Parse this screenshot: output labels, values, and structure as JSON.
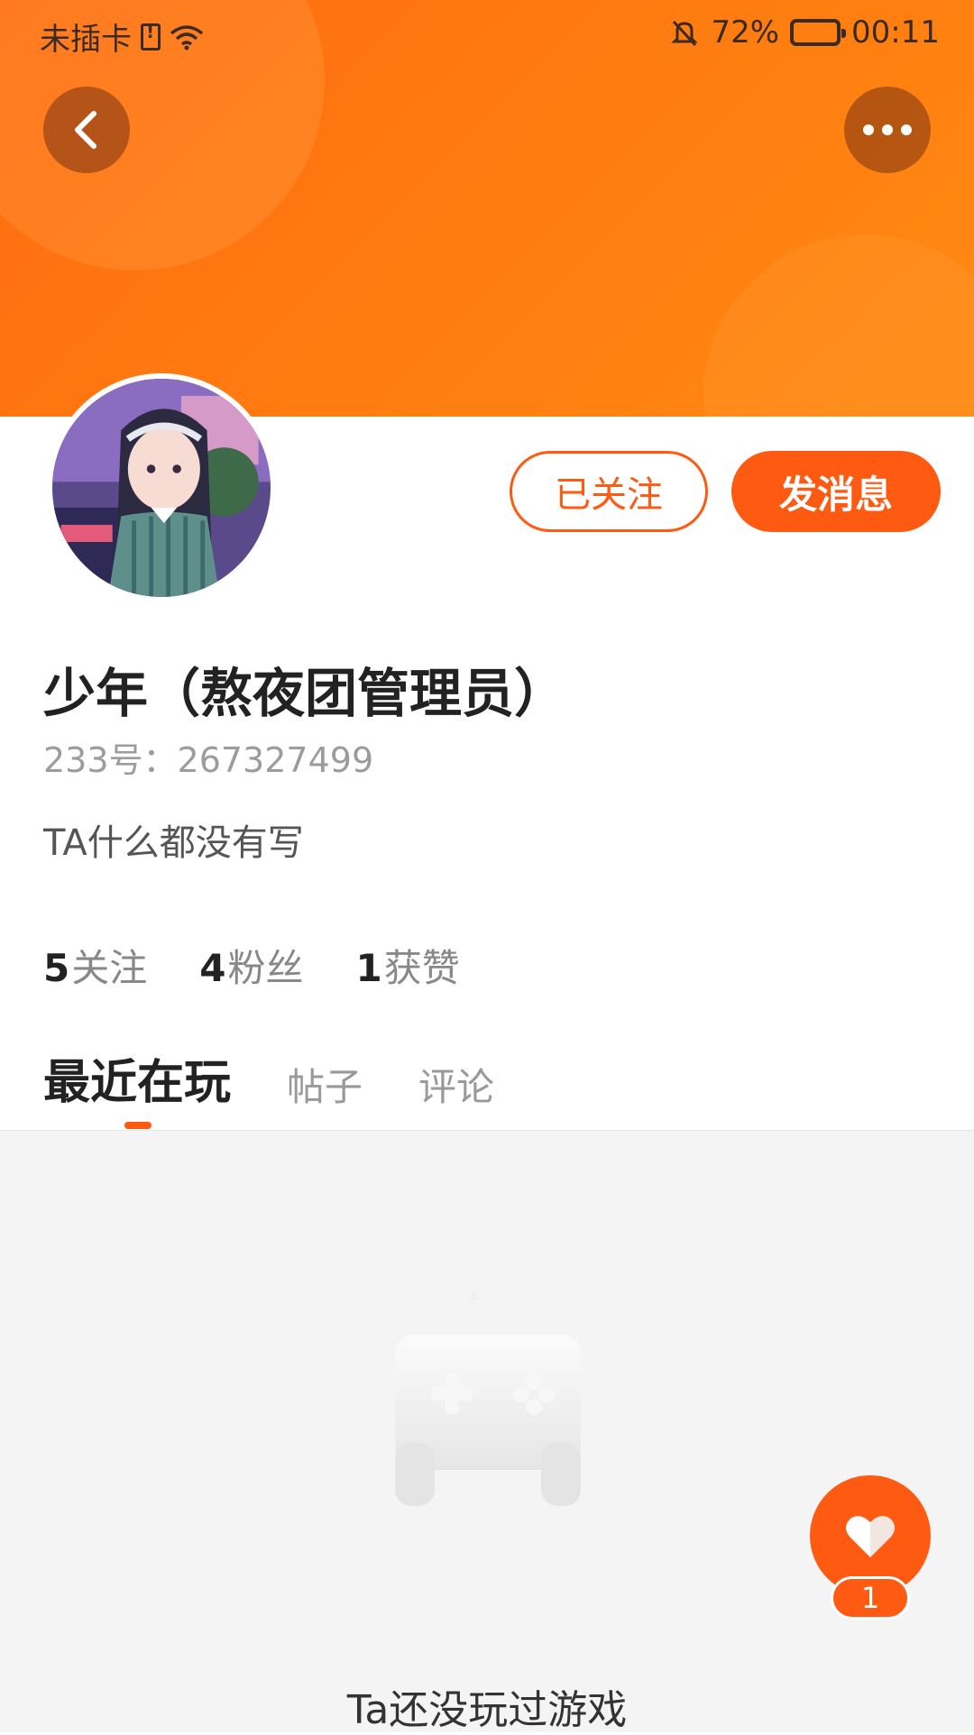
{
  "status_bar": {
    "carrier": "未插卡",
    "battery_percent": "72%",
    "battery_level": 0.72,
    "time": "00:11"
  },
  "header": {
    "back_icon": "chevron-left-icon",
    "more_icon": "more-dots-icon"
  },
  "profile": {
    "name": "少年（熬夜团管理员）",
    "uid": "233号：267327499",
    "bio": "TA什么都没有写",
    "follow_button": "已关注",
    "message_button": "发消息"
  },
  "stats": [
    {
      "count": "5",
      "label": "关注"
    },
    {
      "count": "4",
      "label": "粉丝"
    },
    {
      "count": "1",
      "label": "获赞"
    }
  ],
  "tabs": [
    {
      "label": "最近在玩",
      "active": true
    },
    {
      "label": "帖子",
      "active": false
    },
    {
      "label": "评论",
      "active": false
    }
  ],
  "empty_state": {
    "icon": "gamepad-icon",
    "text": "Ta还没玩过游戏"
  },
  "like_fab": {
    "icon": "heart-icon",
    "count": "1"
  },
  "colors": {
    "accent": "#ff5a12",
    "banner": "#ff7a10"
  }
}
